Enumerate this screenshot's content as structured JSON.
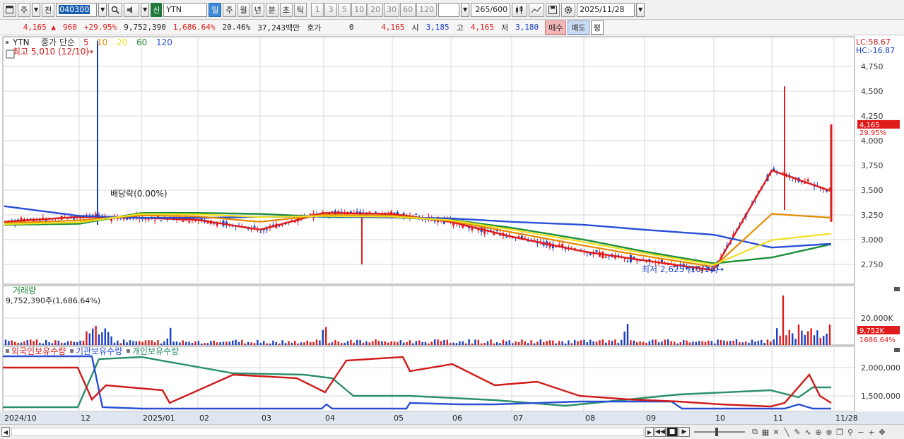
{
  "toolbar": {
    "window_icon": "window-icon",
    "market": "주",
    "prev": "전",
    "code": "040300",
    "search_icon": "magnifier-icon",
    "sound_icon": "speaker-icon",
    "new_tag": "신",
    "stock_name": "YTN",
    "periods": [
      "일",
      "주",
      "월",
      "년",
      "분",
      "초",
      "틱"
    ],
    "selected_period": "일",
    "intervals": [
      "1",
      "3",
      "5",
      "10",
      "20",
      "30",
      "60",
      "120"
    ],
    "bar_count": "265",
    "bar_max": "/600",
    "date": "2025/11/28"
  },
  "quote": {
    "price": "4,165",
    "change": "960",
    "change_pct": "+29.95%",
    "volume": "9,752,390",
    "volume_ratio": "1,686.64%",
    "turnover": "20.46%",
    "amount": "37,243백만",
    "hoga_label": "호가",
    "hoga_value": "0",
    "hoga_price": "4,165",
    "open_label": "시",
    "open": "3,185",
    "high_label": "고",
    "high": "4,165",
    "low_label": "저",
    "low": "3,180",
    "buy_button": "매수",
    "sell_button": "매도",
    "flat_button": "평"
  },
  "price_panel": {
    "ticker_tag": "YTN",
    "ma_legend": [
      {
        "label": "종가 단순",
        "color": "#333333"
      },
      {
        "label": "5",
        "color": "#e01b1b"
      },
      {
        "label": "10",
        "color": "#e58a00"
      },
      {
        "label": "20",
        "color": "#f0e020"
      },
      {
        "label": "60",
        "color": "#1e8f3a"
      },
      {
        "label": "120",
        "color": "#2a4fd6"
      }
    ],
    "high_note": "최고 5,010 (12/10)",
    "low_note": "최저 2,625 (10/14)",
    "dividend_note": "배당락(0.00%)",
    "lc": "LC:58.67",
    "hc": "HC:-16.87",
    "price_tag": "4,165",
    "pct_tag": "29.95%",
    "y_ticks": [
      "4,750",
      "4,500",
      "4,250",
      "4,000",
      "3,750",
      "3,500",
      "3,250",
      "3,000",
      "2,750"
    ]
  },
  "volume_panel": {
    "title": "거래량",
    "summary": "9,752,390주(1,686.64%)",
    "y_tick": "20,000K",
    "vol_tag": "9,752K",
    "vol_pct_tag": "1686.64%"
  },
  "holding_panel": {
    "legend": [
      {
        "label": "외국인보유수량",
        "color": "#d01a1a"
      },
      {
        "label": "기관보유수량",
        "color": "#2a4fd6"
      },
      {
        "label": "개인보유수량",
        "color": "#2a8f6a"
      }
    ],
    "y_ticks": [
      "2,000,000",
      "1,500,000"
    ]
  },
  "x_axis": {
    "labels": [
      "2024/10",
      "12",
      "2025/01",
      "02",
      "03",
      "04",
      "05",
      "06",
      "07",
      "08",
      "09",
      "10",
      "11",
      "11/28"
    ]
  },
  "colors": {
    "up": "#e01b1b",
    "down": "#1a3fc4",
    "grid": "#d8d8d8",
    "panel_border": "#9a9a9a"
  },
  "chart_data": [
    {
      "type": "line",
      "title": "YTN",
      "x": [
        "2024/10",
        "12",
        "2025/01",
        "02",
        "03",
        "04",
        "05",
        "06",
        "07",
        "08",
        "09",
        "10",
        "11",
        "11/28"
      ],
      "series": [
        {
          "name": "5",
          "values": [
            3180,
            3230,
            3220,
            3200,
            3100,
            3270,
            3260,
            3180,
            3030,
            2880,
            2790,
            2690,
            3700,
            3480
          ]
        },
        {
          "name": "60",
          "values": [
            3150,
            3160,
            3270,
            3270,
            3260,
            3230,
            3225,
            3200,
            3120,
            3000,
            2880,
            2760,
            2820,
            2960
          ]
        },
        {
          "name": "120",
          "values": [
            3340,
            3240,
            3220,
            3220,
            3230,
            3235,
            3225,
            3215,
            3180,
            3150,
            3100,
            3050,
            2920,
            2960
          ]
        }
      ],
      "ylim": [
        2550,
        5050
      ]
    }
  ]
}
